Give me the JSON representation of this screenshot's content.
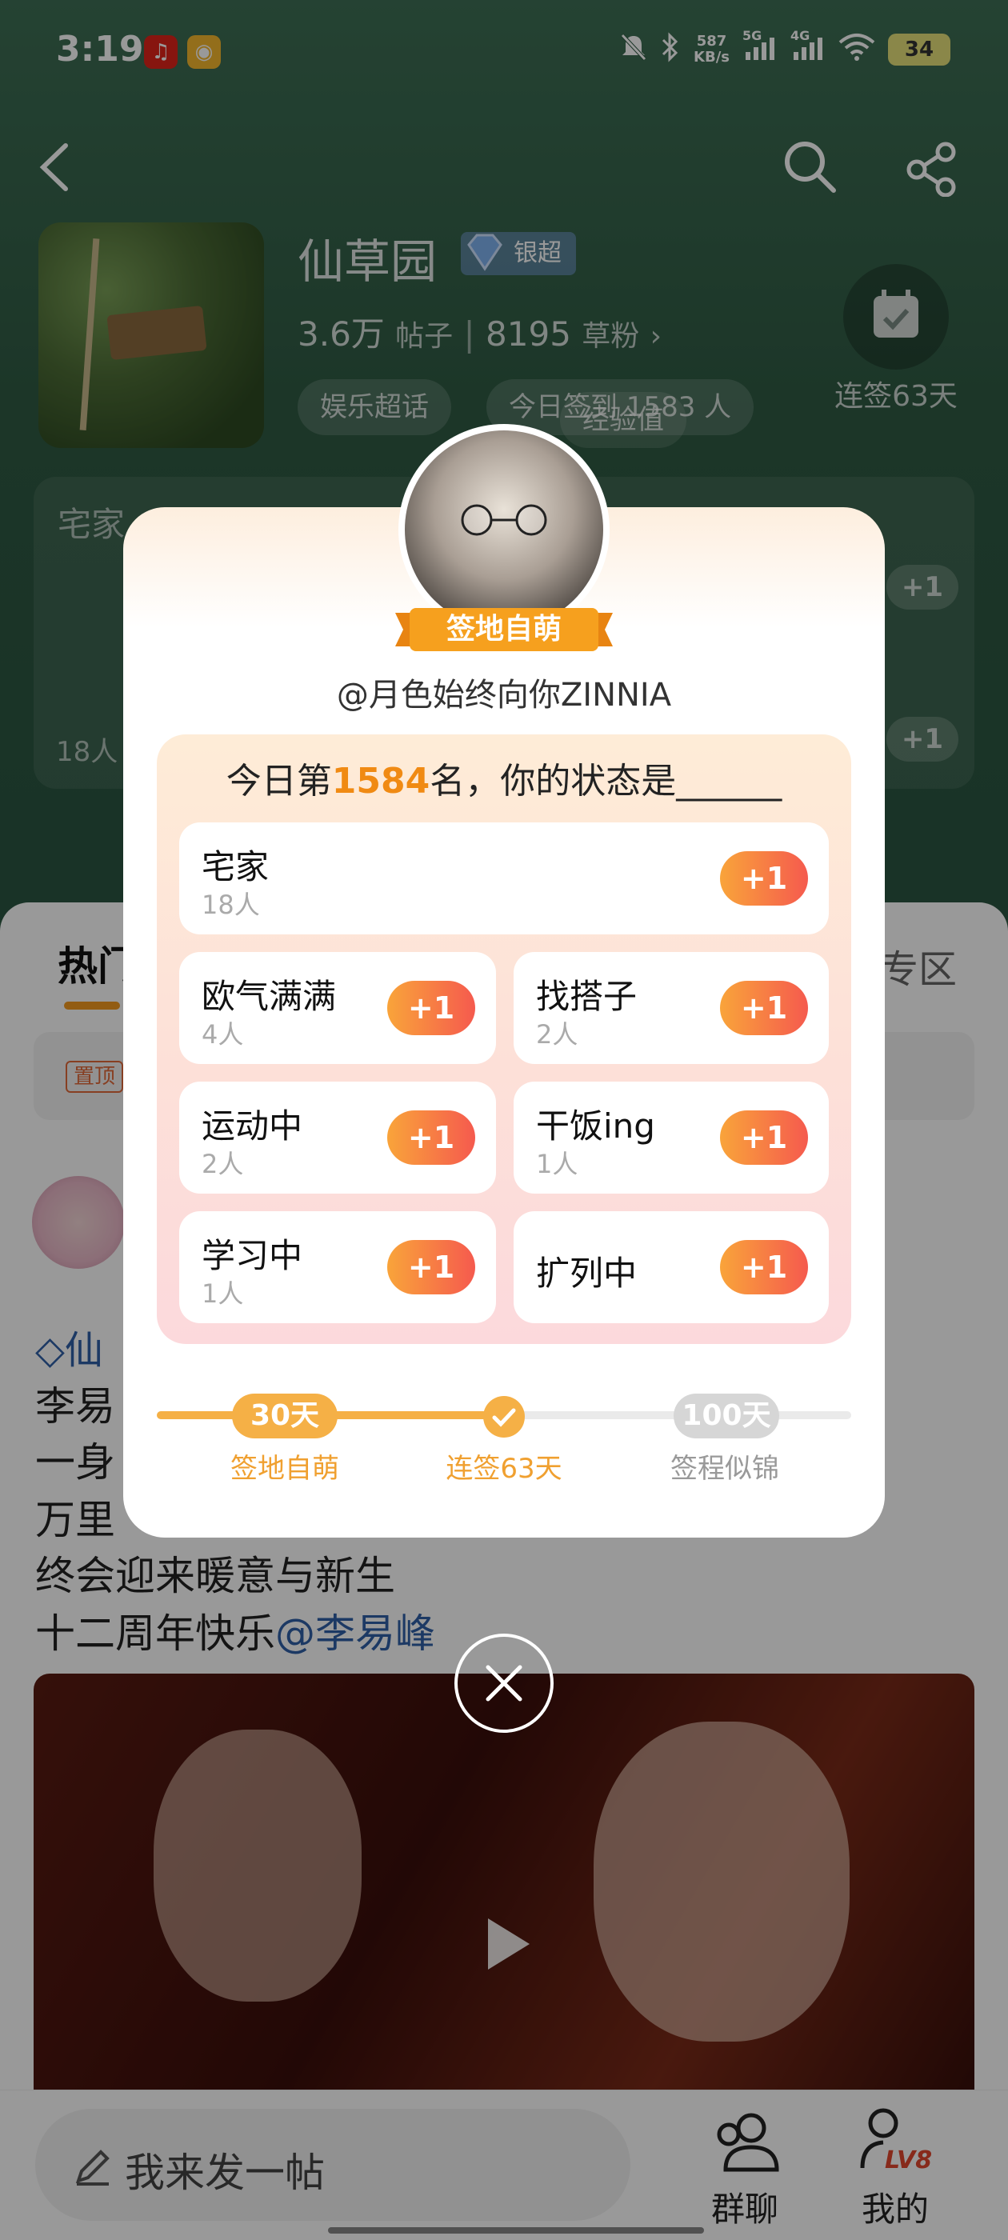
{
  "status_bar": {
    "time": "3:19",
    "net_speed_value": "587",
    "net_speed_unit": "KB/s",
    "net_1": "5G",
    "net_2": "4G",
    "battery": "34"
  },
  "forum": {
    "title": "仙草园",
    "badge": "银超",
    "posts_count": "3.6万",
    "posts_label": "帖子",
    "fans_count": "8195",
    "fans_label": "草粉",
    "tags": [
      "娱乐超话",
      "今日签到 1583 人",
      "经验值"
    ],
    "checkin_label": "连签63天"
  },
  "bg_status_card": {
    "first_status": "宅家",
    "people": "18人",
    "plus": "+1"
  },
  "tabs": {
    "hot": "热门",
    "right": "专区"
  },
  "pinned": {
    "tag": "置顶"
  },
  "post": {
    "forum_link": "仙",
    "lines": [
      "李易",
      "一身",
      "万里",
      "终会迎来暖意与新生",
      "十二周年快乐"
    ],
    "mention": "@李易峰"
  },
  "bottom_bar": {
    "compose_placeholder": "我来发一帖",
    "group_chat": "群聊",
    "mine": "我的",
    "level": "LV8"
  },
  "modal": {
    "rank_title": "签地自萌",
    "username": "@月色始终向你ZINNIA",
    "header_prefix": "今日第",
    "rank_number": "1584",
    "header_suffix": "名，你的状态是______",
    "plus_label": "+1",
    "options": [
      {
        "name": "宅家",
        "count": "18人"
      },
      {
        "name": "欧气满满",
        "count": "4人"
      },
      {
        "name": "找搭子",
        "count": "2人"
      },
      {
        "name": "运动中",
        "count": "2人"
      },
      {
        "name": "干饭ing",
        "count": "1人"
      },
      {
        "name": "学习中",
        "count": "1人"
      },
      {
        "name": "扩列中",
        "count": ""
      }
    ],
    "progress": {
      "current_days": 63,
      "max_days": 100,
      "milestones": [
        {
          "badge": "30天",
          "label": "签地自萌",
          "reached": true
        },
        {
          "badge": "",
          "label": "连签63天",
          "reached": true
        },
        {
          "badge": "100天",
          "label": "签程似锦",
          "reached": false
        }
      ]
    }
  },
  "colors": {
    "accent_orange": "#f08a13",
    "plus_gradient_start": "#f9a43a",
    "plus_gradient_end": "#f55a4e",
    "link_blue": "#2f5fa7"
  }
}
